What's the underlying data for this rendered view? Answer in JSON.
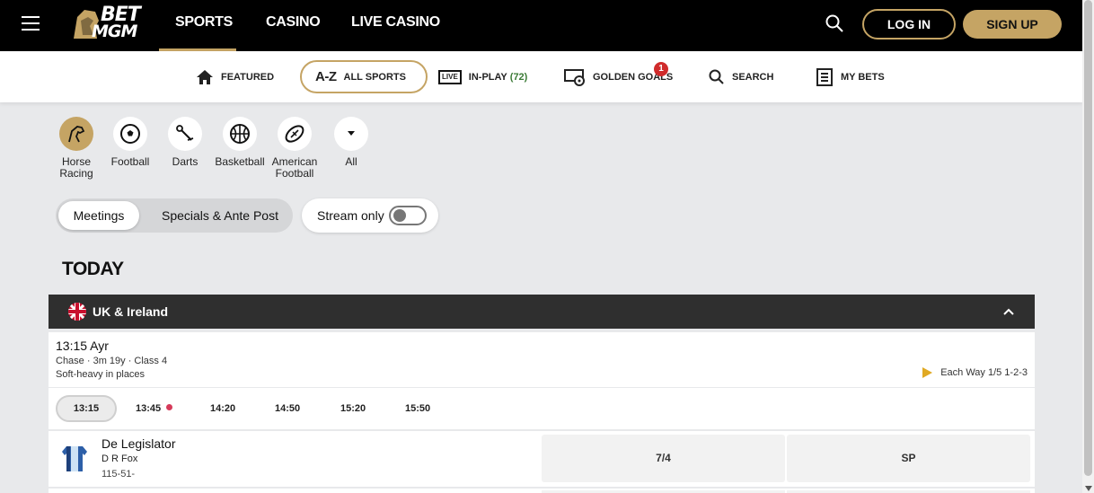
{
  "header": {
    "logo_text_line1": "BET",
    "logo_text_line2": "MGM",
    "nav": [
      "SPORTS",
      "CASINO",
      "LIVE CASINO"
    ],
    "active_nav": "SPORTS",
    "login_label": "LOG IN",
    "signup_label": "SIGN UP",
    "accent_color": "#c5a464"
  },
  "subnav": {
    "featured": "FEATURED",
    "az": "A-Z",
    "all_sports": "ALL SPORTS",
    "live_badge": "LIVE",
    "in_play": "IN-PLAY",
    "in_play_count": "(72)",
    "golden_goals": "GOLDEN GOALS",
    "golden_goals_badge": "1",
    "search": "SEARCH",
    "my_bets": "MY BETS"
  },
  "sports": [
    {
      "label": "Horse Racing",
      "icon": "horse-racing-icon",
      "active": true
    },
    {
      "label": "Football",
      "icon": "football-icon",
      "active": false
    },
    {
      "label": "Darts",
      "icon": "darts-icon",
      "active": false
    },
    {
      "label": "Basketball",
      "icon": "basketball-icon",
      "active": false
    },
    {
      "label": "American Football",
      "icon": "american-football-icon",
      "active": false
    },
    {
      "label": "All",
      "icon": "chevron-down-icon",
      "active": false
    }
  ],
  "filters": {
    "meetings": "Meetings",
    "specials": "Specials & Ante Post",
    "stream_only": "Stream only"
  },
  "section_title": "TODAY",
  "region": {
    "name": "UK & Ireland"
  },
  "race": {
    "title": "13:15 Ayr",
    "details": "Chase · 3m 19y · Class 4",
    "going": "Soft-heavy in places",
    "each_way": "Each Way 1/5 1-2-3",
    "times": [
      "13:15",
      "13:45",
      "14:20",
      "14:50",
      "15:20",
      "15:50"
    ],
    "selected_time": "13:15",
    "live_time": "13:45"
  },
  "runners": [
    {
      "name": "De Legislator",
      "jockey": "D R Fox",
      "form": "115-51-",
      "odds": "7/4",
      "sp": "SP"
    }
  ]
}
